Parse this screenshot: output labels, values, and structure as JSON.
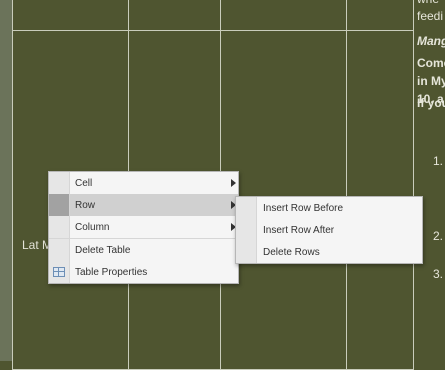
{
  "page": {
    "cell_text": "Lat M",
    "right_column_lines": [
      {
        "text": "whe",
        "style": "normal"
      },
      {
        "text": "feedi",
        "style": "normal"
      },
      {
        "text": "Mang",
        "style": "italic-bold"
      },
      {
        "text": "Come",
        "style": "bold"
      },
      {
        "text": "in My",
        "style": "bold"
      },
      {
        "text": "10, a",
        "style": "bold"
      },
      {
        "text": "If you",
        "style": "bold"
      },
      {
        "text": "1.",
        "style": "normal"
      },
      {
        "text": "2.",
        "style": "normal"
      },
      {
        "text": "3.",
        "style": "normal"
      }
    ]
  },
  "context_menu": {
    "items": [
      {
        "label": "Cell",
        "has_submenu": true,
        "active": false
      },
      {
        "label": "Row",
        "has_submenu": true,
        "active": true
      },
      {
        "label": "Column",
        "has_submenu": true,
        "active": false
      },
      {
        "label": "Delete Table",
        "has_submenu": false,
        "active": false
      },
      {
        "label": "Table Properties",
        "has_submenu": false,
        "active": false,
        "icon": "table-properties-icon"
      }
    ]
  },
  "row_submenu": {
    "items": [
      {
        "label": "Insert Row Before"
      },
      {
        "label": "Insert Row After"
      },
      {
        "label": "Delete Rows"
      }
    ]
  }
}
